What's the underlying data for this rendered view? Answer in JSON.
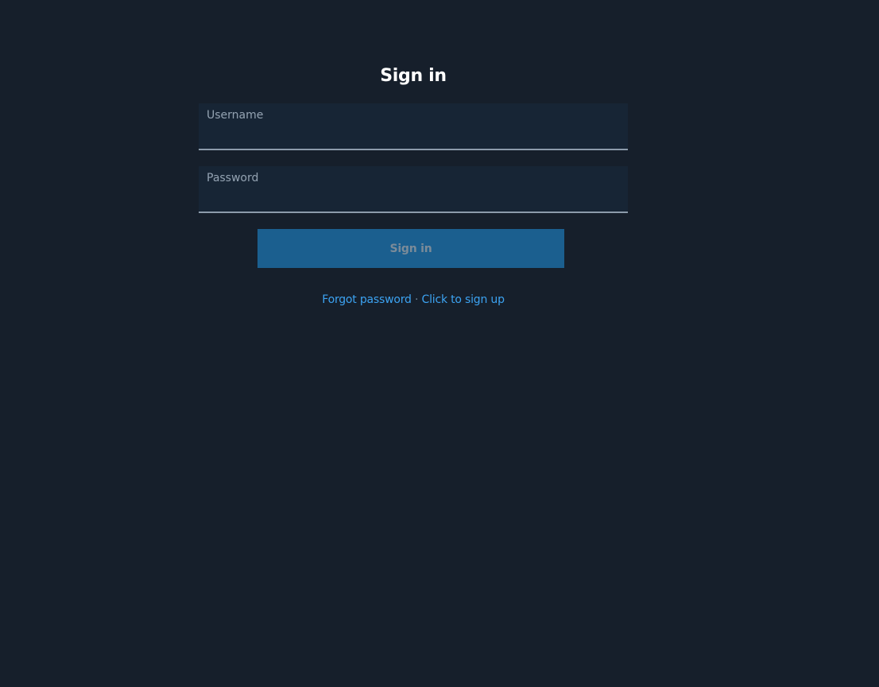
{
  "page": {
    "title": "Sign in"
  },
  "form": {
    "username": {
      "label": "Username",
      "value": ""
    },
    "password": {
      "label": "Password",
      "value": ""
    },
    "submit_label": "Sign in"
  },
  "links": {
    "forgot_password": "Forgot password",
    "separator": "·",
    "sign_up": "Click to sign up"
  },
  "colors": {
    "background": "#161f2b",
    "field_background": "#172535",
    "button_background": "#1b5f8f",
    "link": "#3ca3f2"
  }
}
